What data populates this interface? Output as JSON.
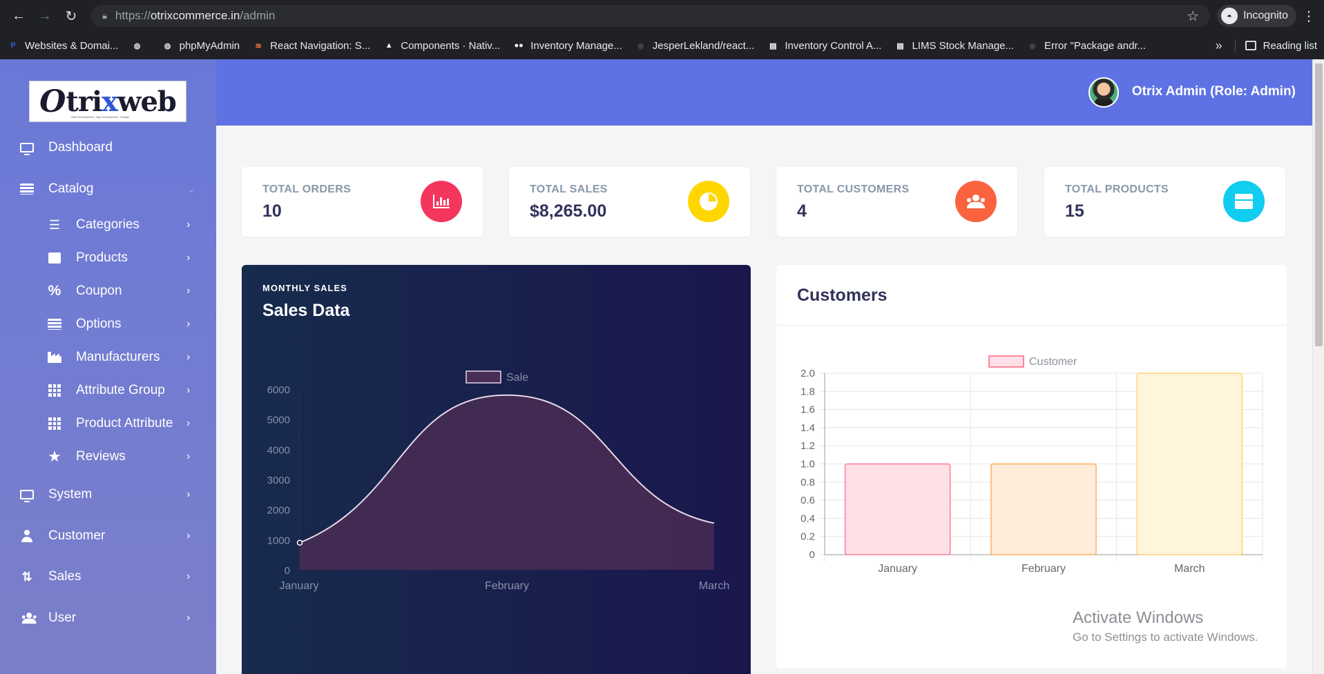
{
  "browser": {
    "url_scheme": "https://",
    "url_host": "otrixcommerce.in",
    "url_path": "/admin",
    "profile_label": "Incognito",
    "bookmarks": [
      {
        "label": "Websites & Domai...",
        "icon": "p-icon",
        "color": "#3b5bdb"
      },
      {
        "label": "",
        "icon": "globe-icon",
        "color": "#dadce0"
      },
      {
        "label": "phpMyAdmin",
        "icon": "globe-icon",
        "color": "#dadce0"
      },
      {
        "label": "React Navigation: S...",
        "icon": "stack-icon",
        "color": "#f4753b"
      },
      {
        "label": "Components · Nativ...",
        "icon": "triangle-icon",
        "color": "#ffffff"
      },
      {
        "label": "Inventory Manage...",
        "icon": "medium-icon",
        "color": "#ffffff"
      },
      {
        "label": "JesperLekland/react...",
        "icon": "github-icon",
        "color": "#444"
      },
      {
        "label": "Inventory Control A...",
        "icon": "doc-icon",
        "color": "#ffffff"
      },
      {
        "label": "LIMS Stock Manage...",
        "icon": "doc-icon",
        "color": "#ffffff"
      },
      {
        "label": "Error \"Package andr...",
        "icon": "github-icon",
        "color": "#444"
      }
    ],
    "reading_list": "Reading list"
  },
  "sidebar": {
    "logo": "Otrixweb",
    "items": [
      {
        "label": "Dashboard",
        "icon": "monitor-icon"
      },
      {
        "label": "Catalog",
        "icon": "list-icon"
      },
      {
        "label": "Categories",
        "icon": "list-check-icon"
      },
      {
        "label": "Products",
        "icon": "box-icon"
      },
      {
        "label": "Coupon",
        "icon": "percent-icon"
      },
      {
        "label": "Options",
        "icon": "list-icon"
      },
      {
        "label": "Manufacturers",
        "icon": "factory-icon"
      },
      {
        "label": "Attribute Group",
        "icon": "grid-icon"
      },
      {
        "label": "Product Attribute",
        "icon": "grid-icon"
      },
      {
        "label": "Reviews",
        "icon": "star-icon"
      },
      {
        "label": "System",
        "icon": "laptop-icon"
      },
      {
        "label": "Customer",
        "icon": "user-icon"
      },
      {
        "label": "Sales",
        "icon": "sort-icon"
      },
      {
        "label": "User",
        "icon": "users-icon"
      }
    ]
  },
  "header": {
    "admin_name": "Otrix Admin (Role: Admin)"
  },
  "stats": [
    {
      "title": "TOTAL ORDERS",
      "value": "10",
      "icon": "bar-chart-icon",
      "color": "#f5365c"
    },
    {
      "title": "TOTAL SALES",
      "value": "$8,265.00",
      "icon": "pie-chart-icon",
      "color": "#ffd600"
    },
    {
      "title": "TOTAL CUSTOMERS",
      "value": "4",
      "icon": "users-icon",
      "color": "#fb6340"
    },
    {
      "title": "TOTAL PRODUCTS",
      "value": "15",
      "icon": "box-icon",
      "color": "#11cdef"
    }
  ],
  "sales_card": {
    "subtitle": "MONTHLY SALES",
    "title": "Sales Data"
  },
  "customers_card": {
    "title": "Customers"
  },
  "watermark": {
    "line1": "Activate Windows",
    "line2": "Go to Settings to activate Windows."
  },
  "chart_data": [
    {
      "type": "area",
      "categories": [
        "January",
        "February",
        "March"
      ],
      "series": [
        {
          "name": "Sale",
          "values": [
            900,
            5800,
            1550
          ]
        }
      ],
      "ylim": [
        0,
        6000
      ],
      "yticks": [
        0,
        1000,
        2000,
        3000,
        4000,
        5000,
        6000
      ],
      "legend": "top",
      "colors": {
        "line": "#e8d8e8",
        "fill": "#4a2d55"
      }
    },
    {
      "type": "bar",
      "categories": [
        "January",
        "February",
        "March"
      ],
      "series": [
        {
          "name": "Customer",
          "values": [
            1,
            1,
            2
          ]
        }
      ],
      "ylim": [
        0,
        2
      ],
      "yticks": [
        "0",
        "0.2",
        "0.4",
        "0.6",
        "0.8",
        "1.0",
        "1.2",
        "1.4",
        "1.6",
        "1.8",
        "2.0"
      ],
      "legend": "top",
      "bar_colors": [
        {
          "fill": "#ffe0e6",
          "stroke": "#ff6384"
        },
        {
          "fill": "#ffecd9",
          "stroke": "#ff9f40"
        },
        {
          "fill": "#fff5dd",
          "stroke": "#ffcd56"
        }
      ]
    }
  ]
}
